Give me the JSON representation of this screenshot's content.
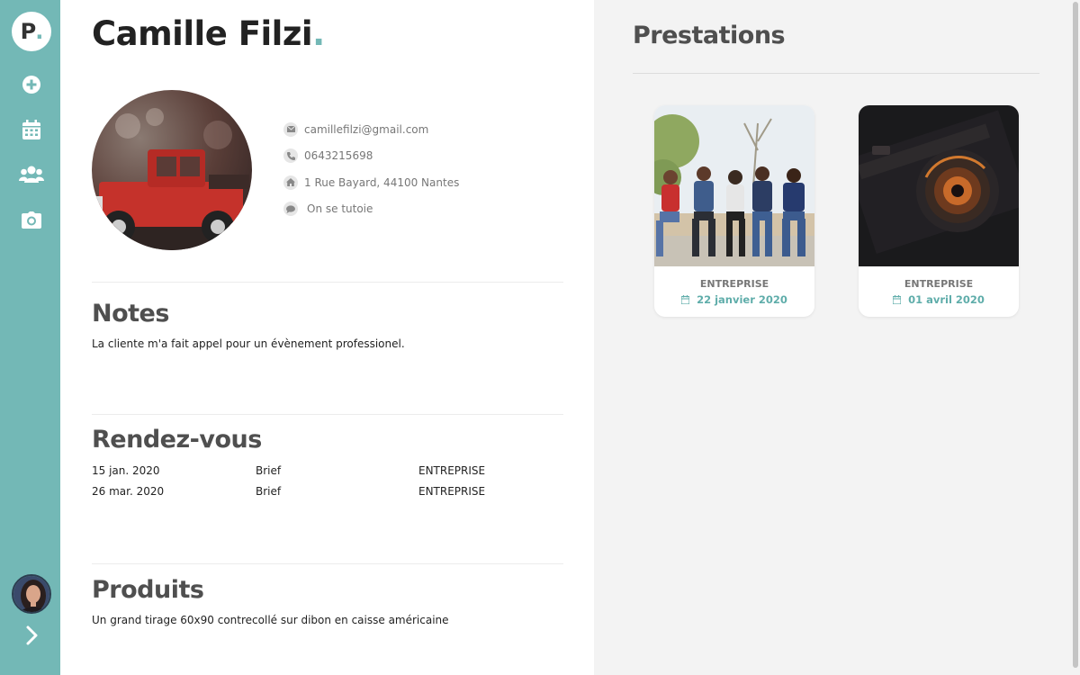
{
  "app": {
    "logo_letter": "P",
    "logo_dot": ".",
    "accent_color": "#73b8b6"
  },
  "sidebar": {
    "items": [
      {
        "icon": "plus-circle-icon",
        "label": "Ajouter"
      },
      {
        "icon": "calendar-icon",
        "label": "Calendrier"
      },
      {
        "icon": "users-icon",
        "label": "Clients"
      },
      {
        "icon": "camera-icon",
        "label": "Prestations"
      }
    ],
    "user_avatar": "user-avatar",
    "expand_icon": "chevron-right-icon"
  },
  "client": {
    "name": "Camille Filzi",
    "name_dot": ".",
    "email": "camillefilzi@gmail.com",
    "phone": "0643215698",
    "address": "1 Rue Bayard, 44100 Nantes",
    "note": "On se tutoie"
  },
  "notes": {
    "title": "Notes",
    "text": "La cliente m'a fait appel pour un évènement professionel."
  },
  "rendezvous": {
    "title": "Rendez-vous",
    "rows": [
      {
        "date": "15 jan. 2020",
        "type": "Brief",
        "category": "ENTREPRISE"
      },
      {
        "date": "26 mar. 2020",
        "type": "Brief",
        "category": "ENTREPRISE"
      }
    ]
  },
  "produits": {
    "title": "Produits",
    "text": "Un grand tirage 60x90 contrecollé sur dibon en caisse américaine"
  },
  "prestations": {
    "title": "Prestations",
    "cards": [
      {
        "category": "ENTREPRISE",
        "date": "22 janvier 2020",
        "image": "group-photo"
      },
      {
        "category": "ENTREPRISE",
        "date": "01 avril 2020",
        "image": "camera-photo"
      }
    ]
  }
}
